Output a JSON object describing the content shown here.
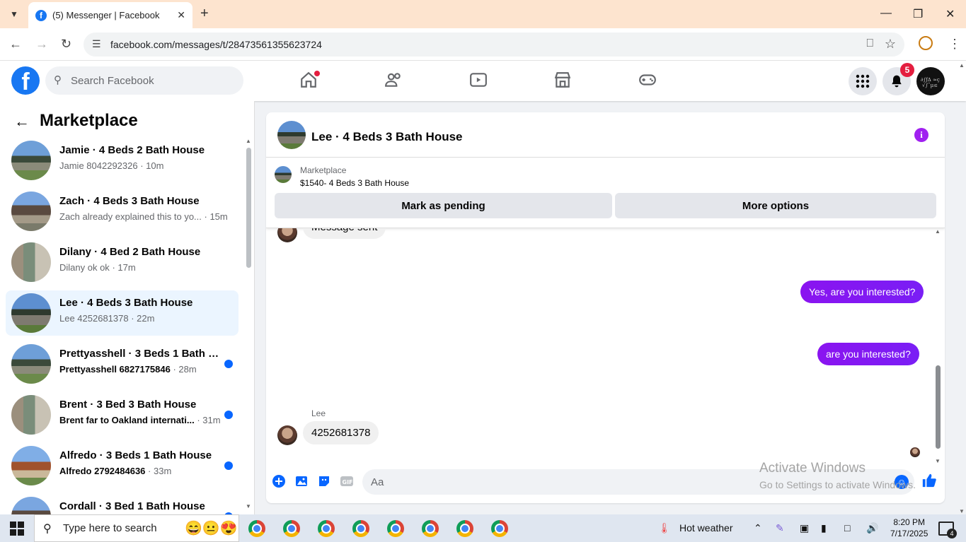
{
  "browser": {
    "tab_title": "(5) Messenger | Facebook",
    "url": "facebook.com/messages/t/28473561355623724"
  },
  "fb": {
    "search_placeholder": "Search Facebook",
    "notification_count": "5"
  },
  "sidebar": {
    "title": "Marketplace",
    "conversations": [
      {
        "name": "Jamie · 4 Beds 2 Bath House",
        "preview": "Jamie 8042292326",
        "time": "· 10m",
        "unread": false
      },
      {
        "name": "Zach · 4 Beds 3 Bath House",
        "preview": "Zach already explained this to yo...",
        "time": "· 15m",
        "unread": false
      },
      {
        "name": "Dilany · 4 Bed 2 Bath House",
        "preview": "Dilany ok ok",
        "time": "· 17m",
        "unread": false
      },
      {
        "name": "Lee · 4 Beds 3 Bath House",
        "preview": "Lee 4252681378",
        "time": "· 22m",
        "unread": false,
        "selected": true
      },
      {
        "name": "Prettyasshell · 3 Beds 1 Bath H...",
        "preview": "Prettyasshell 6827175846",
        "time": "· 28m",
        "unread": true
      },
      {
        "name": "Brent · 3 Bed 3 Bath House",
        "preview": "Brent far to Oakland internati...",
        "time": "· 31m",
        "unread": true
      },
      {
        "name": "Alfredo · 3 Beds 1 Bath House",
        "preview": "Alfredo 2792484636",
        "time": "· 33m",
        "unread": true
      },
      {
        "name": "Cordall · 3 Bed 1 Bath House",
        "preview": "",
        "time": "",
        "unread": true
      }
    ]
  },
  "chat": {
    "title": "Lee · 4 Beds 3 Bath House",
    "marketplace_label": "Marketplace",
    "listing": "$1540- 4 Beds 3 Bath House",
    "mark_pending": "Mark as pending",
    "more_options": "More options",
    "messages": [
      {
        "from": "them",
        "text": "Message sent"
      },
      {
        "from": "me",
        "text": "Yes, are you interested?"
      },
      {
        "from": "me",
        "text": "are you  interested?"
      },
      {
        "from": "them",
        "sender": "Lee",
        "text": "4252681378"
      }
    ],
    "composer_placeholder": "Aa"
  },
  "watermark": {
    "line1": "Activate Windows",
    "line2": "Go to Settings to activate Windows."
  },
  "taskbar": {
    "search_placeholder": "Type here to search",
    "weather": "Hot weather",
    "time": "8:20 PM",
    "date": "7/17/2025",
    "notifications": "4"
  }
}
